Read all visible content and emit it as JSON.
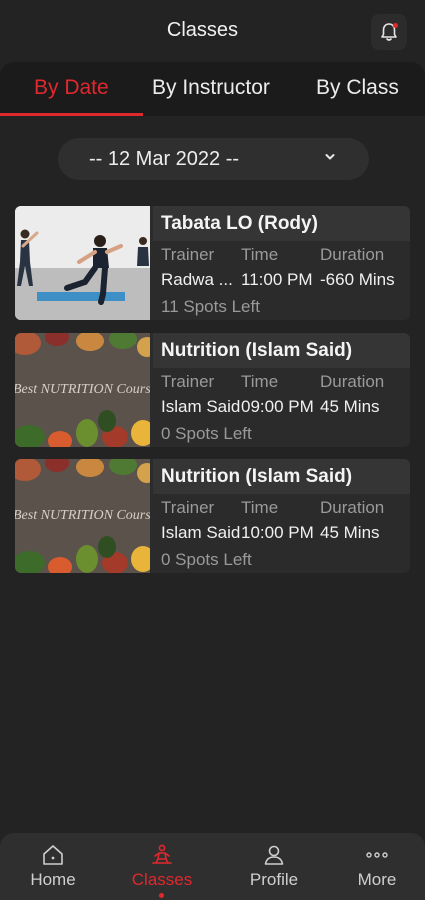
{
  "header": {
    "title": "Classes"
  },
  "tabs": [
    {
      "label": "By Date",
      "active": true
    },
    {
      "label": "By Instructor",
      "active": false
    },
    {
      "label": "By Class",
      "active": false
    }
  ],
  "date_picker": {
    "value": "-- 12 Mar 2022 --"
  },
  "columns": {
    "trainer": "Trainer",
    "time": "Time",
    "duration": "Duration"
  },
  "classes": [
    {
      "title": "Tabata LO (Rody)",
      "trainer": "Radwa ...",
      "time": "11:00 PM",
      "duration": "-660 Mins",
      "spots": "11 Spots Left",
      "image": "workout-photo"
    },
    {
      "title": "Nutrition (Islam Said)",
      "trainer": "Islam Said",
      "time": "09:00 PM",
      "duration": "45 Mins",
      "spots": "0 Spots Left",
      "image": "nutrition-course-photo",
      "image_text": "Best NUTRITION Course"
    },
    {
      "title": "Nutrition (Islam Said)",
      "trainer": "Islam Said",
      "time": "10:00 PM",
      "duration": "45 Mins",
      "spots": "0 Spots Left",
      "image": "nutrition-course-photo",
      "image_text": "Best NUTRITION Course"
    }
  ],
  "bottom_nav": [
    {
      "label": "Home",
      "icon": "home-icon",
      "active": false
    },
    {
      "label": "Classes",
      "icon": "classes-icon",
      "active": true
    },
    {
      "label": "Profile",
      "icon": "profile-icon",
      "active": false
    },
    {
      "label": "More",
      "icon": "more-icon",
      "active": false
    }
  ],
  "colors": {
    "accent": "#e0282e",
    "background": "#232323",
    "card": "#2b2b2b"
  }
}
